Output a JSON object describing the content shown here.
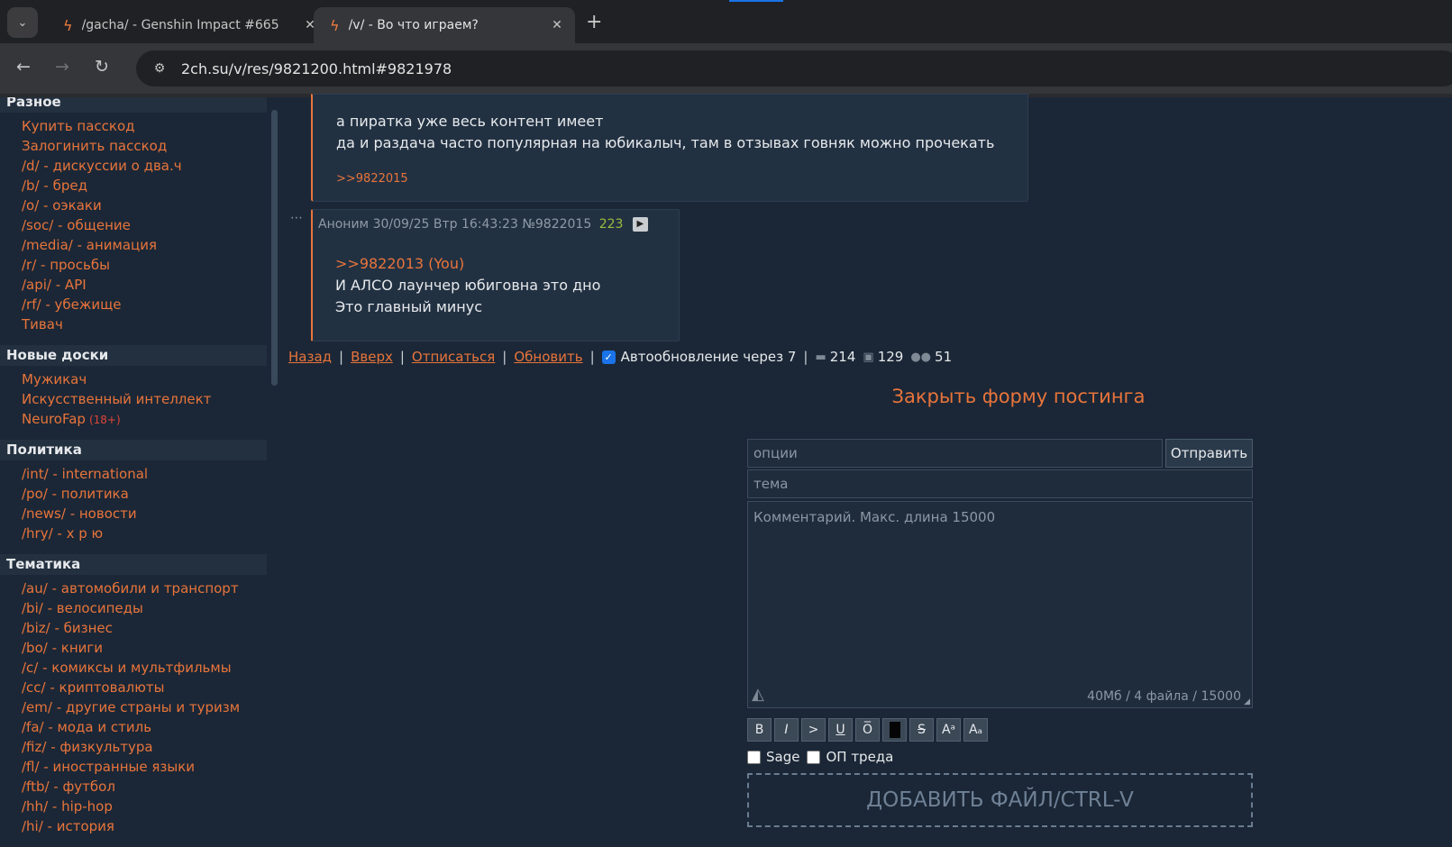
{
  "browser": {
    "tabs": [
      {
        "title": "/gacha/ - Genshin Impact #665",
        "active": false
      },
      {
        "title": "/v/ - Во что играем?",
        "active": true
      }
    ],
    "url": "2ch.su/v/res/9821200.html#9821978"
  },
  "sidebar": {
    "sections": [
      {
        "title": "Разное",
        "boards": [
          {
            "label": "Купить пасскод"
          },
          {
            "label": "Залогинить пасскод"
          },
          {
            "label": "/d/ - дискуссии о два.ч"
          },
          {
            "label": "/b/ - бред"
          },
          {
            "label": "/o/ - оэкаки"
          },
          {
            "label": "/soc/ - общение"
          },
          {
            "label": "/media/ - анимация"
          },
          {
            "label": "/r/ - просьбы"
          },
          {
            "label": "/api/ - API"
          },
          {
            "label": "/rf/ - убежище"
          },
          {
            "label": "Тивач"
          }
        ]
      },
      {
        "title": "Новые доски",
        "boards": [
          {
            "label": "Мужикач"
          },
          {
            "label": "Искусственный интеллект"
          },
          {
            "label": "NeuroFap",
            "badge": "(18+)"
          }
        ]
      },
      {
        "title": "Политика",
        "boards": [
          {
            "label": "/int/ - international"
          },
          {
            "label": "/po/ - политика"
          },
          {
            "label": "/news/ - новости"
          },
          {
            "label": "/hry/ - х р ю"
          }
        ]
      },
      {
        "title": "Тематика",
        "boards": [
          {
            "label": "/au/ - автомобили и транспорт"
          },
          {
            "label": "/bi/ - велосипеды"
          },
          {
            "label": "/biz/ - бизнес"
          },
          {
            "label": "/bo/ - книги"
          },
          {
            "label": "/c/ - комиксы и мультфильмы"
          },
          {
            "label": "/cc/ - криптовалюты"
          },
          {
            "label": "/em/ - другие страны и туризм"
          },
          {
            "label": "/fa/ - мода и стиль"
          },
          {
            "label": "/fiz/ - физкультура"
          },
          {
            "label": "/fl/ - иностранные языки"
          },
          {
            "label": "/ftb/ - футбол"
          },
          {
            "label": "/hh/ - hip-hop"
          },
          {
            "label": "/hi/ - история"
          }
        ]
      }
    ]
  },
  "post1": {
    "lines": [
      "а пиратка уже весь контент имеет",
      "да и раздача часто популярная на юбикалыч, там в отзывах говняк можно прочекать"
    ],
    "reply": ">>9822015"
  },
  "post2": {
    "name": "Аноним",
    "date": "30/09/25 Втр 16:43:23",
    "number": "№9822015",
    "count": "223",
    "reply": ">>9822013 (You)",
    "lines": [
      "И АЛСО лаунчер юбиговна это дно",
      "Это главный минус"
    ]
  },
  "threadnav": {
    "back": "Назад",
    "up": "Вверх",
    "unsubscribe": "Отписаться",
    "refresh": "Обновить",
    "autoupdate": "Автообновление через 7",
    "posts": "214",
    "images": "129",
    "users": "51"
  },
  "form": {
    "toggle": "Закрыть форму постинга",
    "options_placeholder": "опции",
    "send": "Отправить",
    "subject_placeholder": "тема",
    "comment_placeholder": "Комментарий. Макс. длина 15000",
    "limits": "40Мб / 4 файла / 15000",
    "format_buttons": [
      "B",
      "I",
      ">",
      "U",
      "O̅",
      "",
      "S",
      "Aᵃ",
      "Aₐ"
    ],
    "sage": "Sage",
    "op": "ОП треда",
    "dropzone": "ДОБАВИТЬ ФАЙЛ/CTRL-V"
  }
}
